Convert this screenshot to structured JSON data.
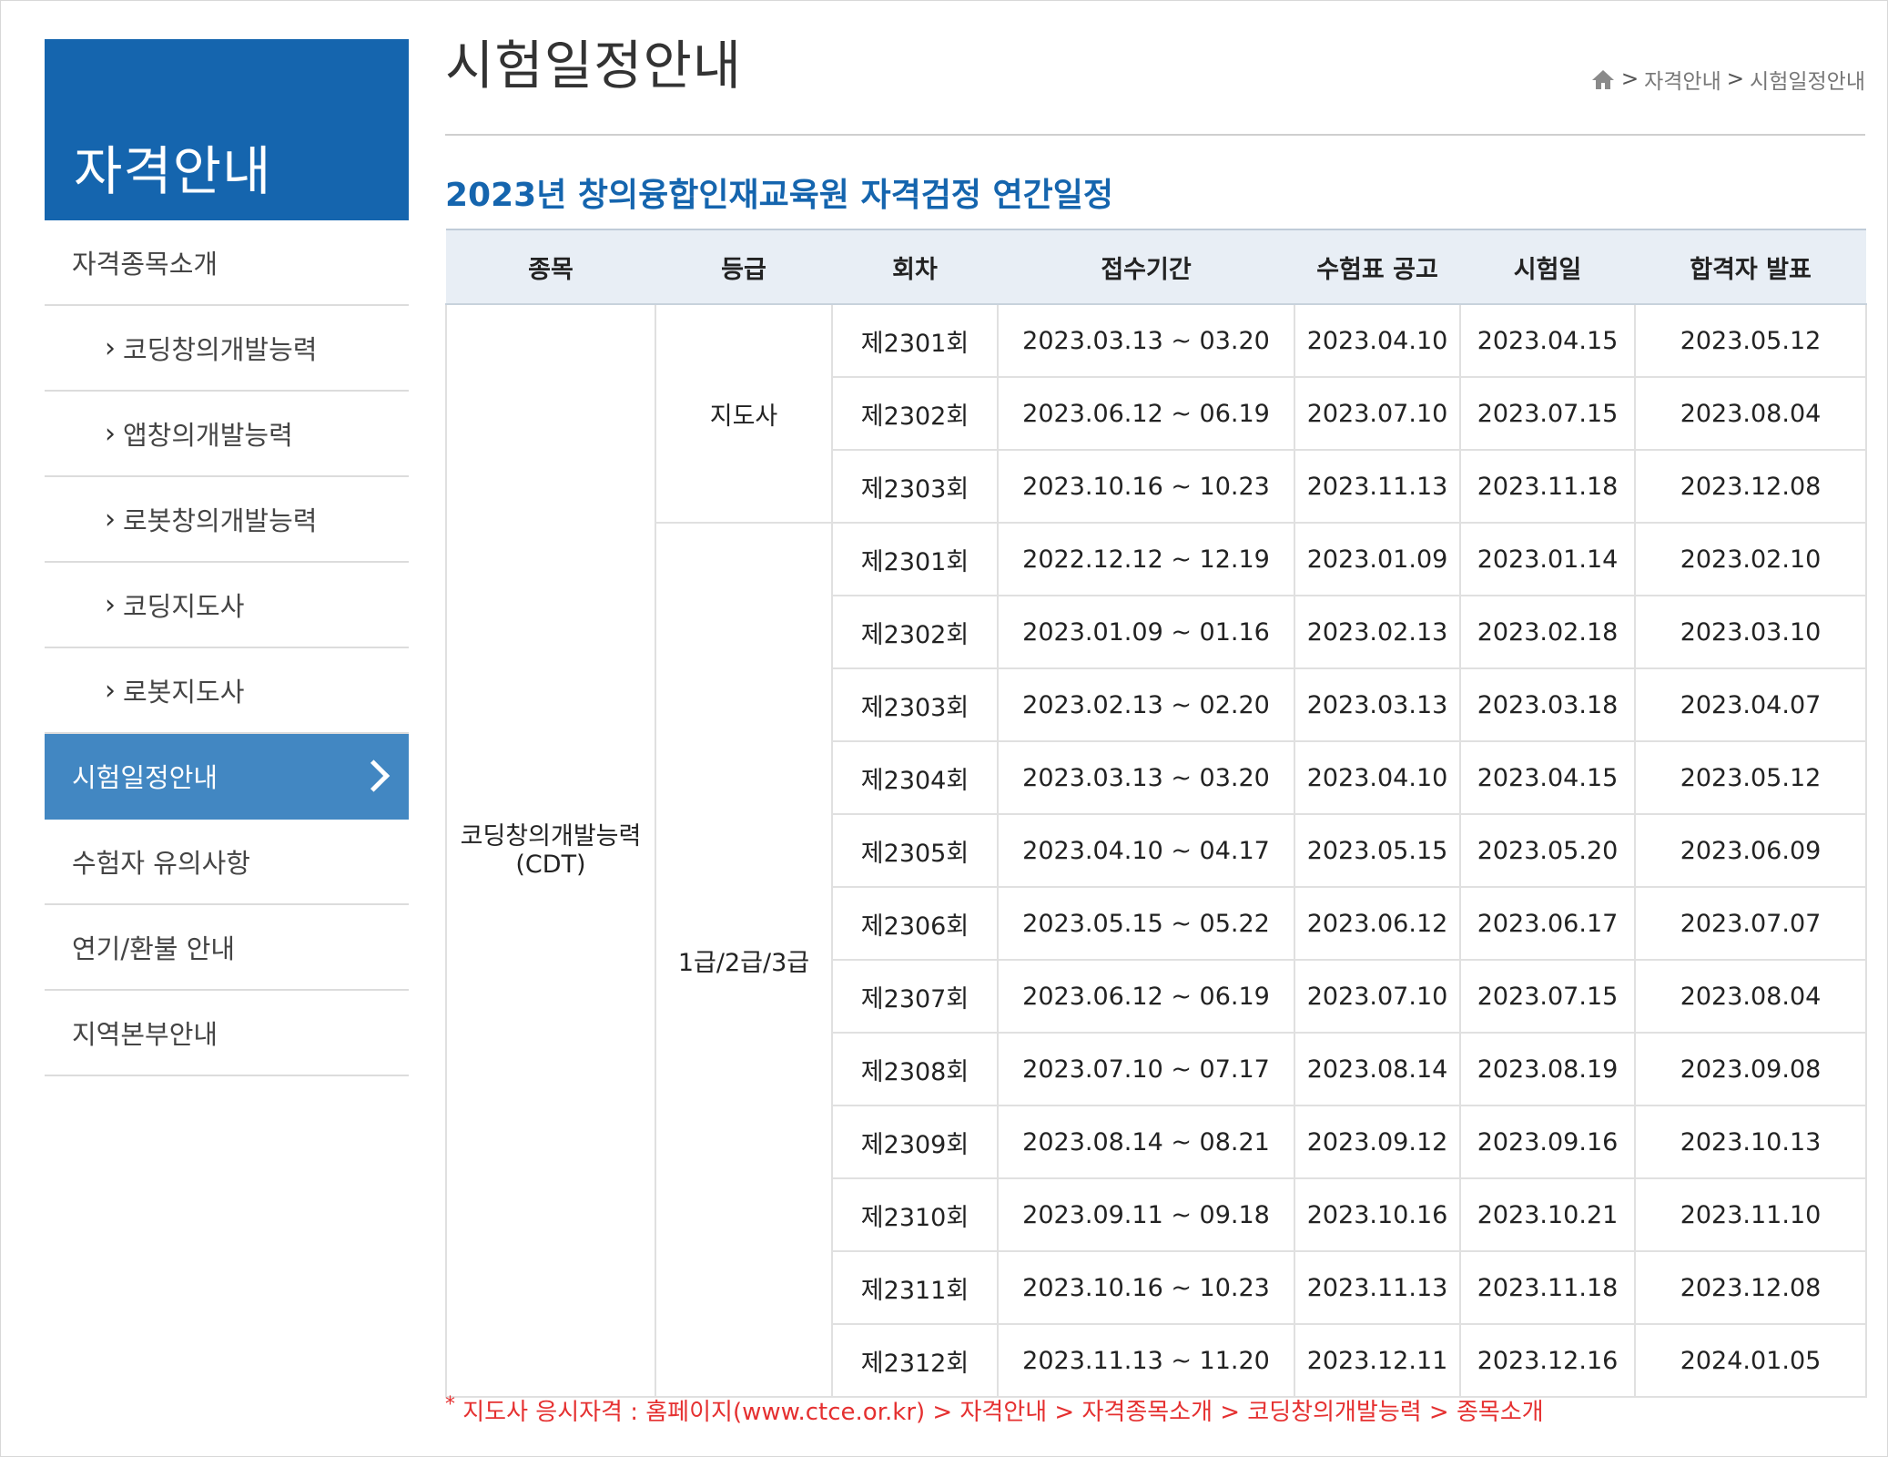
{
  "sidebar": {
    "heading": "자격안내",
    "items": [
      {
        "label": "자격종목소개",
        "sub": false,
        "active": false
      },
      {
        "label": "코딩창의개발능력",
        "sub": true,
        "active": false
      },
      {
        "label": "앱창의개발능력",
        "sub": true,
        "active": false
      },
      {
        "label": "로봇창의개발능력",
        "sub": true,
        "active": false
      },
      {
        "label": "코딩지도사",
        "sub": true,
        "active": false
      },
      {
        "label": "로봇지도사",
        "sub": true,
        "active": false
      },
      {
        "label": "시험일정안내",
        "sub": false,
        "active": true
      },
      {
        "label": "수험자 유의사항",
        "sub": false,
        "active": false
      },
      {
        "label": "연기/환불 안내",
        "sub": false,
        "active": false
      },
      {
        "label": "지역본부안내",
        "sub": false,
        "active": false
      }
    ]
  },
  "header": {
    "title": "시험일정안내",
    "breadcrumb": [
      "자격안내",
      "시험일정안내"
    ]
  },
  "section_title": "2023년 창의융합인재교육원 자격검정 연간일정",
  "table": {
    "headers": [
      "종목",
      "등급",
      "회차",
      "접수기간",
      "수험표 공고",
      "시험일",
      "합격자 발표"
    ],
    "subject_line1": "코딩창의개발능력",
    "subject_line2": "(CDT)",
    "groups": [
      {
        "grade": "지도사",
        "rows": [
          [
            "제2301회",
            "2023.03.13 ~ 03.20",
            "2023.04.10",
            "2023.04.15",
            "2023.05.12"
          ],
          [
            "제2302회",
            "2023.06.12 ~ 06.19",
            "2023.07.10",
            "2023.07.15",
            "2023.08.04"
          ],
          [
            "제2303회",
            "2023.10.16 ~ 10.23",
            "2023.11.13",
            "2023.11.18",
            "2023.12.08"
          ]
        ]
      },
      {
        "grade": "1급/2급/3급",
        "rows": [
          [
            "제2301회",
            "2022.12.12 ~ 12.19",
            "2023.01.09",
            "2023.01.14",
            "2023.02.10"
          ],
          [
            "제2302회",
            "2023.01.09 ~ 01.16",
            "2023.02.13",
            "2023.02.18",
            "2023.03.10"
          ],
          [
            "제2303회",
            "2023.02.13 ~ 02.20",
            "2023.03.13",
            "2023.03.18",
            "2023.04.07"
          ],
          [
            "제2304회",
            "2023.03.13 ~ 03.20",
            "2023.04.10",
            "2023.04.15",
            "2023.05.12"
          ],
          [
            "제2305회",
            "2023.04.10 ~ 04.17",
            "2023.05.15",
            "2023.05.20",
            "2023.06.09"
          ],
          [
            "제2306회",
            "2023.05.15 ~ 05.22",
            "2023.06.12",
            "2023.06.17",
            "2023.07.07"
          ],
          [
            "제2307회",
            "2023.06.12 ~ 06.19",
            "2023.07.10",
            "2023.07.15",
            "2023.08.04"
          ],
          [
            "제2308회",
            "2023.07.10 ~ 07.17",
            "2023.08.14",
            "2023.08.19",
            "2023.09.08"
          ],
          [
            "제2309회",
            "2023.08.14 ~ 08.21",
            "2023.09.12",
            "2023.09.16",
            "2023.10.13"
          ],
          [
            "제2310회",
            "2023.09.11 ~ 09.18",
            "2023.10.16",
            "2023.10.21",
            "2023.11.10"
          ],
          [
            "제2311회",
            "2023.10.16 ~ 10.23",
            "2023.11.13",
            "2023.11.18",
            "2023.12.08"
          ],
          [
            "제2312회",
            "2023.11.13 ~ 11.20",
            "2023.12.11",
            "2023.12.16",
            "2024.01.05"
          ]
        ]
      }
    ]
  },
  "note": {
    "mark": "*",
    "text": "지도사 응시자격 : 홈페이지(www.ctce.or.kr) > 자격안내 > 자격종목소개 > 코딩창의개발능력 > 종목소개"
  },
  "colors": {
    "brand": "#1565ae",
    "active_menu": "#4287c2",
    "note": "#e53030",
    "table_header_bg": "#e8eef5"
  },
  "icons": {
    "breadcrumb_home": "home-icon",
    "breadcrumb_sep": "chevron-right-icon",
    "active_menu_arrow": "chevron-right-icon"
  }
}
